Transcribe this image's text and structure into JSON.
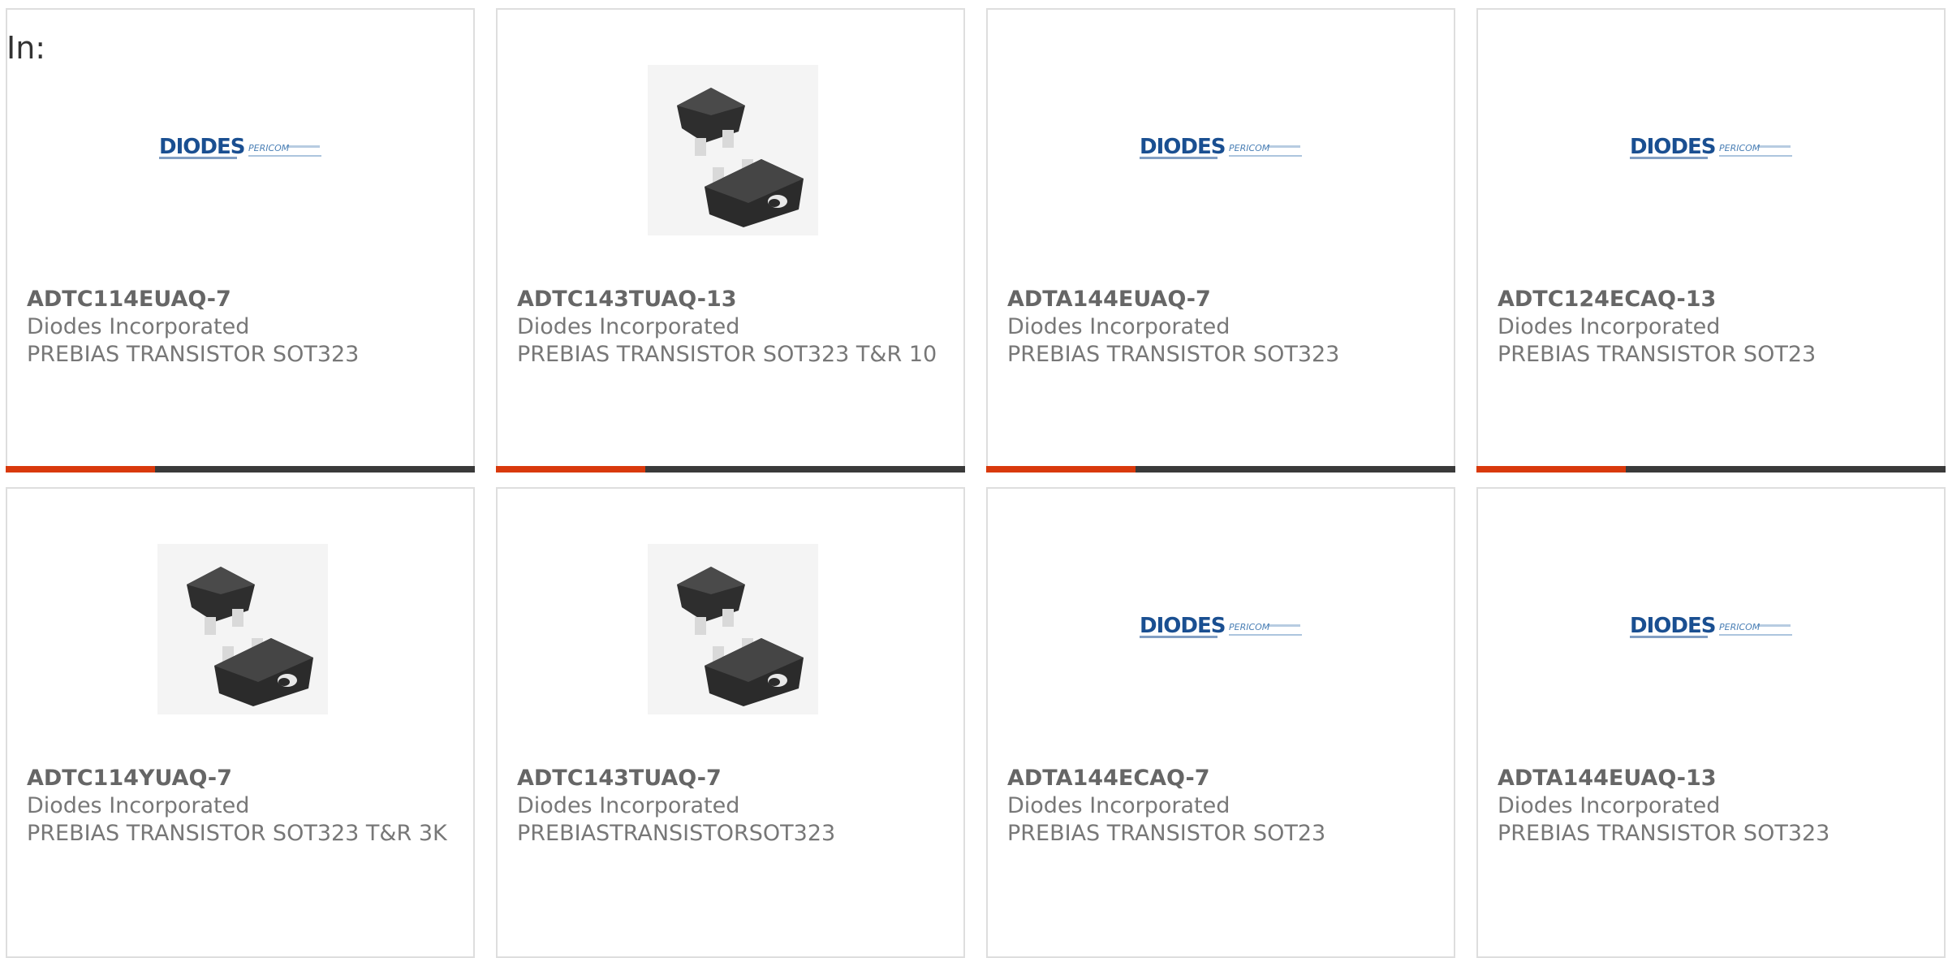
{
  "filter": {
    "label": "In:"
  },
  "colors": {
    "accent": "#d9390c",
    "bar": "#3a3a3a",
    "diodes_blue": "#1a4f91",
    "pericom_blue": "#4a7fb5"
  },
  "products": [
    {
      "part": "ADTC114EUAQ-7",
      "manufacturer": "Diodes Incorporated",
      "description": "PREBIAS TRANSISTOR SOT323",
      "image": "diodes-pericom-logo"
    },
    {
      "part": "ADTC143TUAQ-13",
      "manufacturer": "Diodes Incorporated",
      "description": "PREBIAS TRANSISTOR SOT323 T&R 10",
      "image": "transistor-photo"
    },
    {
      "part": "ADTA144EUAQ-7",
      "manufacturer": "Diodes Incorporated",
      "description": "PREBIAS TRANSISTOR SOT323",
      "image": "diodes-pericom-logo"
    },
    {
      "part": "ADTC124ECAQ-13",
      "manufacturer": "Diodes Incorporated",
      "description": "PREBIAS TRANSISTOR SOT23",
      "image": "diodes-pericom-logo"
    },
    {
      "part": "ADTC114YUAQ-7",
      "manufacturer": "Diodes Incorporated",
      "description": "PREBIAS TRANSISTOR SOT323 T&R 3K",
      "image": "transistor-photo"
    },
    {
      "part": "ADTC143TUAQ-7",
      "manufacturer": "Diodes Incorporated",
      "description": "PREBIASTRANSISTORSOT323",
      "image": "transistor-photo"
    },
    {
      "part": "ADTA144ECAQ-7",
      "manufacturer": "Diodes Incorporated",
      "description": "PREBIAS TRANSISTOR SOT23",
      "image": "diodes-pericom-logo"
    },
    {
      "part": "ADTA144EUAQ-13",
      "manufacturer": "Diodes Incorporated",
      "description": "PREBIAS TRANSISTOR SOT323",
      "image": "diodes-pericom-logo"
    }
  ],
  "logo": {
    "brand": "DIODES",
    "sub_brand": "PERICOM"
  }
}
